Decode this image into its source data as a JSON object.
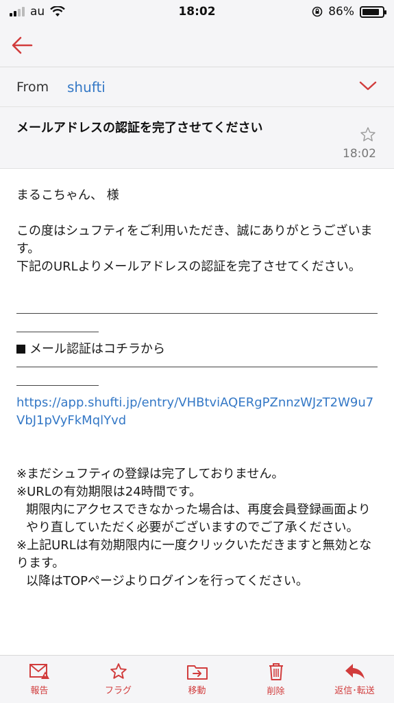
{
  "status": {
    "carrier": "au",
    "time": "18:02",
    "battery": "86%",
    "battery_level": 0.86
  },
  "header": {
    "back_icon": "arrow-left-icon"
  },
  "mail": {
    "from_label": "From",
    "sender": "shufti",
    "subject": "メールアドレスの認証を完了させてください",
    "time": "18:02",
    "body": {
      "greeting": "まるこちゃん、 様",
      "intro_1": "この度はシュフティをご利用いただき、誠にありがとうございます。",
      "intro_2": "下記のURLよりメールアドレスの認証を完了させてください。",
      "cta": "メール認証はコチラから",
      "link": "https://app.shufti.jp/entry/VHBtviAQERgPZnnzWJzT2W9u7VbJ1pVyFkMqlYvd",
      "note_1": "※まだシュフティの登録は完了しておりません。",
      "note_2": "※URLの有効期限は24時間です。",
      "note_3": "期限内にアクセスできなかった場合は、再度会員登録画面よりやり直していただく必要がございますのでご了承ください。",
      "note_4": "※上記URLは有効期限内に一度クリックいただきますと無効となります。",
      "note_5": "以降はTOPページよりログインを行ってください。"
    }
  },
  "toolbar": {
    "report": "報告",
    "flag": "フラグ",
    "move": "移動",
    "delete": "削除",
    "reply": "返信･転送"
  },
  "colors": {
    "accent_red": "#d13c3c",
    "link_blue": "#3478c6"
  }
}
